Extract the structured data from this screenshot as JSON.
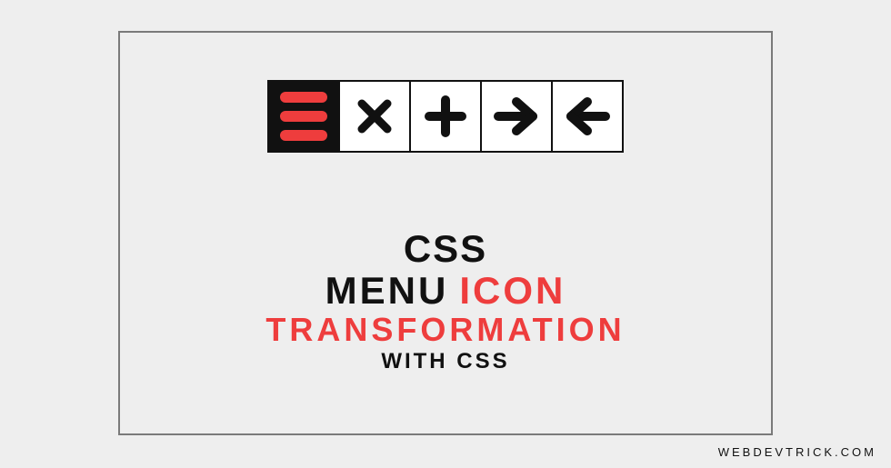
{
  "titles": {
    "line1": "CSS",
    "line2a": "MENU",
    "line2b": "ICON",
    "line3": "TRANSFORMATION",
    "line4": "WITH CSS"
  },
  "watermark": "WEBDEVTRICK.COM",
  "icons": {
    "hamburger": "hamburger",
    "close": "close",
    "plus": "plus",
    "arrow_right": "arrow-right",
    "arrow_left": "arrow-left"
  }
}
